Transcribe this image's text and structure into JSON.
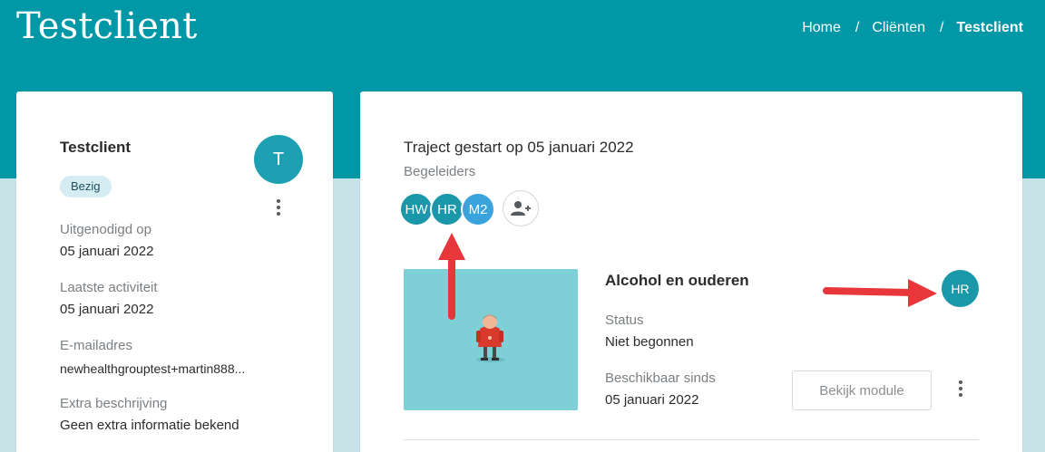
{
  "header": {
    "title": "Testclient",
    "breadcrumb": {
      "home": "Home",
      "clients": "Cliënten",
      "current": "Testclient",
      "separator": "/"
    }
  },
  "client_card": {
    "name": "Testclient",
    "status_badge": "Bezig",
    "avatar_initial": "T",
    "fields": [
      {
        "label": "Uitgenodigd op",
        "value": "05 januari 2022"
      },
      {
        "label": "Laatste activiteit",
        "value": "05 januari 2022"
      },
      {
        "label": "E-mailadres",
        "value": "newhealthgrouptest+martin888..."
      },
      {
        "label": "Extra beschrijving",
        "value": "Geen extra informatie bekend"
      }
    ]
  },
  "trajectory": {
    "title": "Traject gestart op 05 januari 2022",
    "coaches_label": "Begeleiders",
    "coaches": [
      {
        "initials": "HW",
        "color": "#1a97a8"
      },
      {
        "initials": "HR",
        "color": "#1a97a8"
      },
      {
        "initials": "M2",
        "color": "#3aa3dc"
      }
    ],
    "add_coach_icon": "add-user-icon",
    "module": {
      "title": "Alcohol en ouderen",
      "status_label": "Status",
      "status_value": "Niet begonnen",
      "available_label": "Beschikbaar sinds",
      "available_value": "05 januari 2022",
      "assigned_coach": "HR",
      "view_button": "Bekijk module"
    }
  },
  "colors": {
    "brand": "#0097a7",
    "background": "#c8e3e8",
    "arrow": "#e8373a"
  }
}
